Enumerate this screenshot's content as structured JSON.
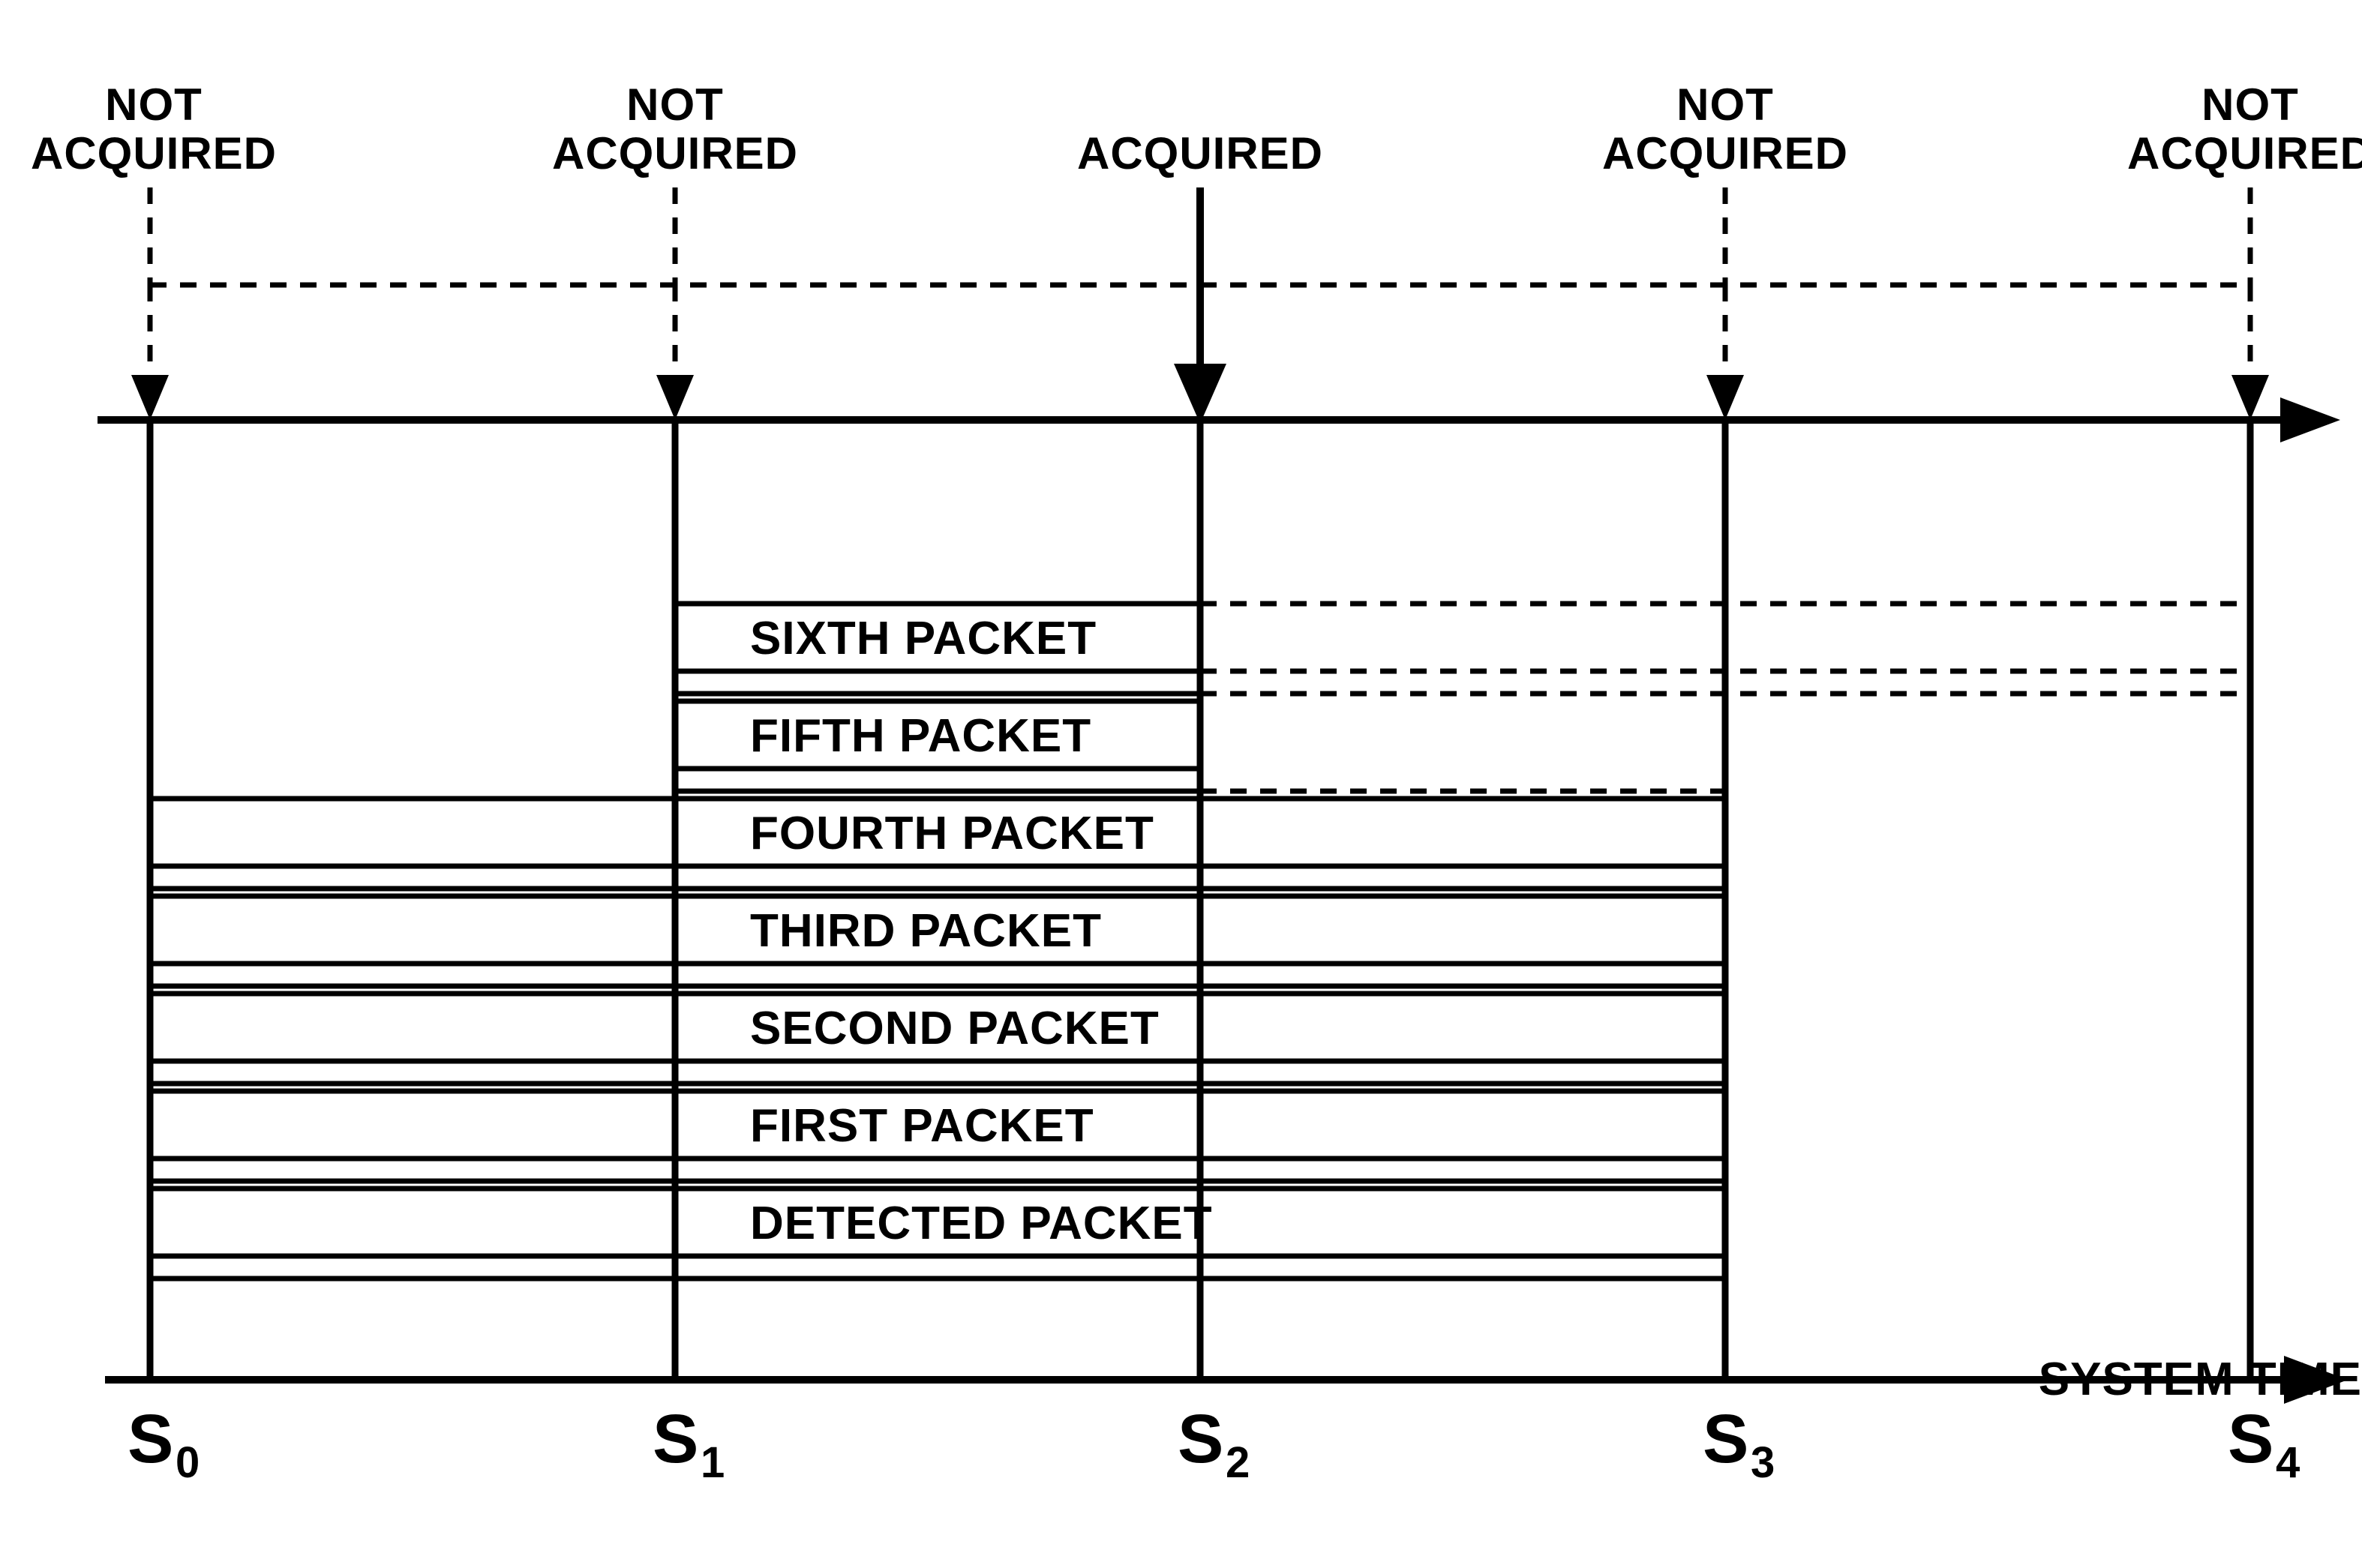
{
  "status": {
    "s0": {
      "line1": "NOT",
      "line2": "ACQUIRED"
    },
    "s1": {
      "line1": "NOT",
      "line2": "ACQUIRED"
    },
    "s2": {
      "line1": "ACQUIRED"
    },
    "s3": {
      "line1": "NOT",
      "line2": "ACQUIRED"
    },
    "s4": {
      "line1": "NOT",
      "line2": "ACQUIRED"
    }
  },
  "packets": {
    "p6": "SIXTH PACKET",
    "p5": "FIFTH PACKET",
    "p4": "FOURTH PACKET",
    "p3": "THIRD PACKET",
    "p2": "SECOND PACKET",
    "p1": "FIRST PACKET",
    "p0": "DETECTED PACKET"
  },
  "axis": {
    "label": "SYSTEM TIME",
    "ticks": {
      "s0": "S",
      "s1": "S",
      "s2": "S",
      "s3": "S",
      "s4": "S"
    },
    "sub": {
      "s0": "0",
      "s1": "1",
      "s2": "2",
      "s3": "3",
      "s4": "4"
    }
  },
  "chart_data": {
    "type": "gantt-like-diagram",
    "time_ticks": [
      "S0",
      "S1",
      "S2",
      "S3",
      "S4"
    ],
    "status_at_ticks": {
      "S0": "NOT ACQUIRED",
      "S1": "NOT ACQUIRED",
      "S2": "ACQUIRED",
      "S3": "NOT ACQUIRED",
      "S4": "NOT ACQUIRED"
    },
    "packets": [
      {
        "name": "DETECTED PACKET",
        "start": "S0",
        "end": "S3"
      },
      {
        "name": "FIRST PACKET",
        "start": "S0",
        "end": "S3"
      },
      {
        "name": "SECOND PACKET",
        "start": "S0",
        "end": "S3"
      },
      {
        "name": "THIRD PACKET",
        "start": "S0",
        "end": "S3"
      },
      {
        "name": "FOURTH PACKET",
        "start": "S0",
        "end": "S3"
      },
      {
        "name": "FIFTH PACKET",
        "start": "S1",
        "end": "S2",
        "dashed_continuation_to": "S4"
      },
      {
        "name": "SIXTH PACKET",
        "start": "S1",
        "end": "S2",
        "dashed_continuation_to": "S4"
      }
    ],
    "axis_label": "SYSTEM TIME"
  }
}
